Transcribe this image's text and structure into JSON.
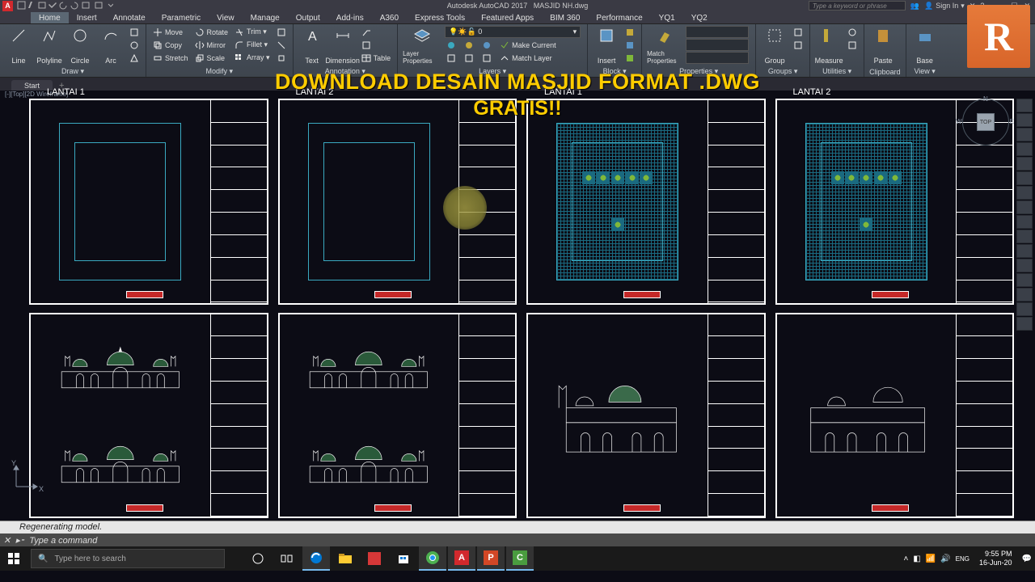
{
  "titlebar": {
    "app": "Autodesk AutoCAD 2017",
    "doc": "MASJID NH.dwg",
    "search_placeholder": "Type a keyword or phrase",
    "signin": "Sign In"
  },
  "menu": {
    "tabs": [
      "Home",
      "Insert",
      "Annotate",
      "Parametric",
      "View",
      "Manage",
      "Output",
      "Add-ins",
      "A360",
      "Express Tools",
      "Featured Apps",
      "BIM 360",
      "Performance",
      "YQ1",
      "YQ2"
    ],
    "active": 0
  },
  "ribbon": {
    "draw": {
      "label": "Draw ▾",
      "line": "Line",
      "polyline": "Polyline",
      "circle": "Circle",
      "arc": "Arc"
    },
    "modify": {
      "label": "Modify ▾",
      "move": "Move",
      "copy": "Copy",
      "stretch": "Stretch",
      "rotate": "Rotate",
      "mirror": "Mirror",
      "scale": "Scale",
      "trim": "Trim ▾",
      "fillet": "Fillet ▾",
      "array": "Array ▾"
    },
    "annotation": {
      "label": "Annotation ▾",
      "text": "Text",
      "dimension": "Dimension",
      "table": "Table"
    },
    "layers": {
      "label": "Layers ▾",
      "properties": "Layer\nProperties",
      "make_current": "Make Current",
      "match": "Match Layer"
    },
    "block": {
      "label": "Block ▾",
      "insert": "Insert"
    },
    "properties": {
      "label": "Properties ▾",
      "match": "Match\nProperties"
    },
    "groups": {
      "label": "Groups ▾",
      "group": "Group"
    },
    "utilities": {
      "label": "Utilities ▾",
      "measure": "Measure"
    },
    "clipboard": {
      "label": "Clipboard",
      "paste": "Paste"
    },
    "view": {
      "label": "View ▾",
      "base": "Base"
    }
  },
  "filetabs": {
    "start": "Start"
  },
  "viewport": {
    "corner": "[-][Top][2D Wireframe]",
    "sheets": [
      {
        "title": "LANTAI 1"
      },
      {
        "title": "LANTAI 2"
      },
      {
        "title": "LANTAI 1"
      },
      {
        "title": "LANTAI 2"
      },
      {
        "title": ""
      },
      {
        "title": ""
      },
      {
        "title": ""
      },
      {
        "title": ""
      }
    ],
    "viewcube": {
      "face": "TOP",
      "n": "N",
      "e": "E",
      "w": "W"
    },
    "ucs": {
      "y": "Y",
      "x": "X"
    }
  },
  "overlay": {
    "line1": "DOWNLOAD DESAIN MASJID FORMAT .DWG",
    "line2": "GRATIS!!",
    "logo": "R"
  },
  "command": {
    "history": "Regenerating model.",
    "placeholder": "Type a command",
    "prompt": "▸⁃"
  },
  "taskbar": {
    "search_placeholder": "Type here to search",
    "clock_time": "9:55 PM",
    "clock_date": "16-Jun-20"
  }
}
